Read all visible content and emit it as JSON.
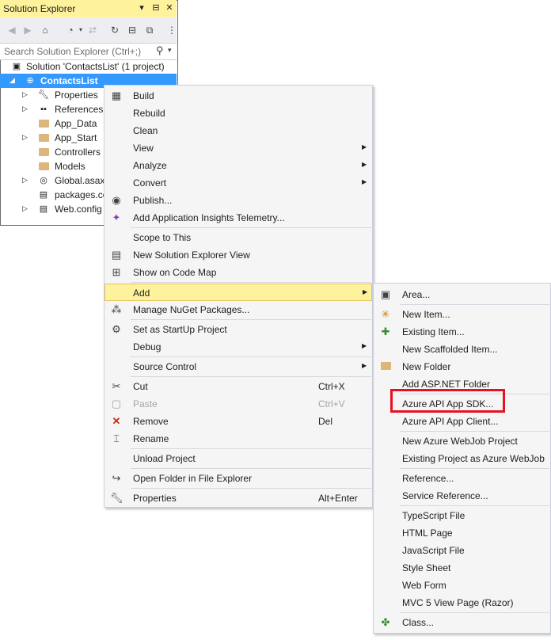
{
  "explorer": {
    "title": "Solution Explorer",
    "title_buttons": [
      "▾",
      "⊟",
      "✕"
    ],
    "search_placeholder": "Search Solution Explorer (Ctrl+;)",
    "solution_label": "Solution 'ContactsList' (1 project)",
    "project_label": "ContactsList",
    "items": [
      {
        "label": "Properties",
        "icon": "wrench-icon"
      },
      {
        "label": "References",
        "icon": "references-icon"
      },
      {
        "label": "App_Data",
        "icon": "folder-icon"
      },
      {
        "label": "App_Start",
        "icon": "folder-icon"
      },
      {
        "label": "Controllers",
        "icon": "folder-icon"
      },
      {
        "label": "Models",
        "icon": "folder-icon"
      },
      {
        "label": "Global.asax",
        "icon": "globe-file-icon"
      },
      {
        "label": "packages.config",
        "icon": "config-file-icon"
      },
      {
        "label": "Web.config",
        "icon": "config-file-icon"
      }
    ]
  },
  "menu": {
    "items": [
      {
        "label": "Build",
        "icon": "build-icon"
      },
      {
        "label": "Rebuild"
      },
      {
        "label": "Clean"
      },
      {
        "label": "View",
        "submenu": true
      },
      {
        "label": "Analyze",
        "submenu": true
      },
      {
        "label": "Convert",
        "submenu": true
      },
      {
        "label": "Publish...",
        "icon": "publish-icon"
      },
      {
        "label": "Add Application Insights Telemetry...",
        "icon": "insights-icon"
      },
      {
        "label": "Scope to This"
      },
      {
        "label": "New Solution Explorer View",
        "icon": "new-view-icon"
      },
      {
        "label": "Show on Code Map",
        "icon": "code-map-icon"
      },
      {
        "label": "Add",
        "submenu": true,
        "highlighted": true
      },
      {
        "label": "Manage NuGet Packages...",
        "icon": "nuget-icon"
      },
      {
        "label": "Set as StartUp Project",
        "icon": "gear-icon"
      },
      {
        "label": "Debug",
        "submenu": true
      },
      {
        "label": "Source Control",
        "submenu": true
      },
      {
        "label": "Cut",
        "shortcut": "Ctrl+X",
        "icon": "scissors-icon"
      },
      {
        "label": "Paste",
        "shortcut": "Ctrl+V",
        "icon": "paste-icon",
        "disabled": true
      },
      {
        "label": "Remove",
        "shortcut": "Del",
        "icon": "remove-icon"
      },
      {
        "label": "Rename",
        "icon": "rename-icon"
      },
      {
        "label": "Unload Project"
      },
      {
        "label": "Open Folder in File Explorer",
        "icon": "open-folder-icon"
      },
      {
        "label": "Properties",
        "shortcut": "Alt+Enter",
        "icon": "wrench-icon"
      }
    ]
  },
  "submenu": {
    "items": [
      {
        "label": "Area...",
        "icon": "area-icon"
      },
      {
        "label": "New Item...",
        "icon": "new-item-icon"
      },
      {
        "label": "Existing Item...",
        "icon": "existing-item-icon"
      },
      {
        "label": "New Scaffolded Item..."
      },
      {
        "label": "New Folder",
        "icon": "new-folder-icon"
      },
      {
        "label": "Add ASP.NET Folder",
        "submenu": true
      },
      {
        "label": "Azure API App SDK...",
        "marked": true
      },
      {
        "label": "Azure API App Client..."
      },
      {
        "label": "New Azure WebJob Project"
      },
      {
        "label": "Existing Project as Azure WebJob"
      },
      {
        "label": "Reference..."
      },
      {
        "label": "Service Reference..."
      },
      {
        "label": "TypeScript File"
      },
      {
        "label": "HTML Page"
      },
      {
        "label": "JavaScript File"
      },
      {
        "label": "Style Sheet"
      },
      {
        "label": "Web Form"
      },
      {
        "label": "MVC 5 View Page (Razor)"
      },
      {
        "label": "Class...",
        "icon": "class-icon"
      }
    ]
  },
  "colors": {
    "highlight": "#fff29d",
    "selection": "#3399ff",
    "annotation_box": "#e81123"
  }
}
